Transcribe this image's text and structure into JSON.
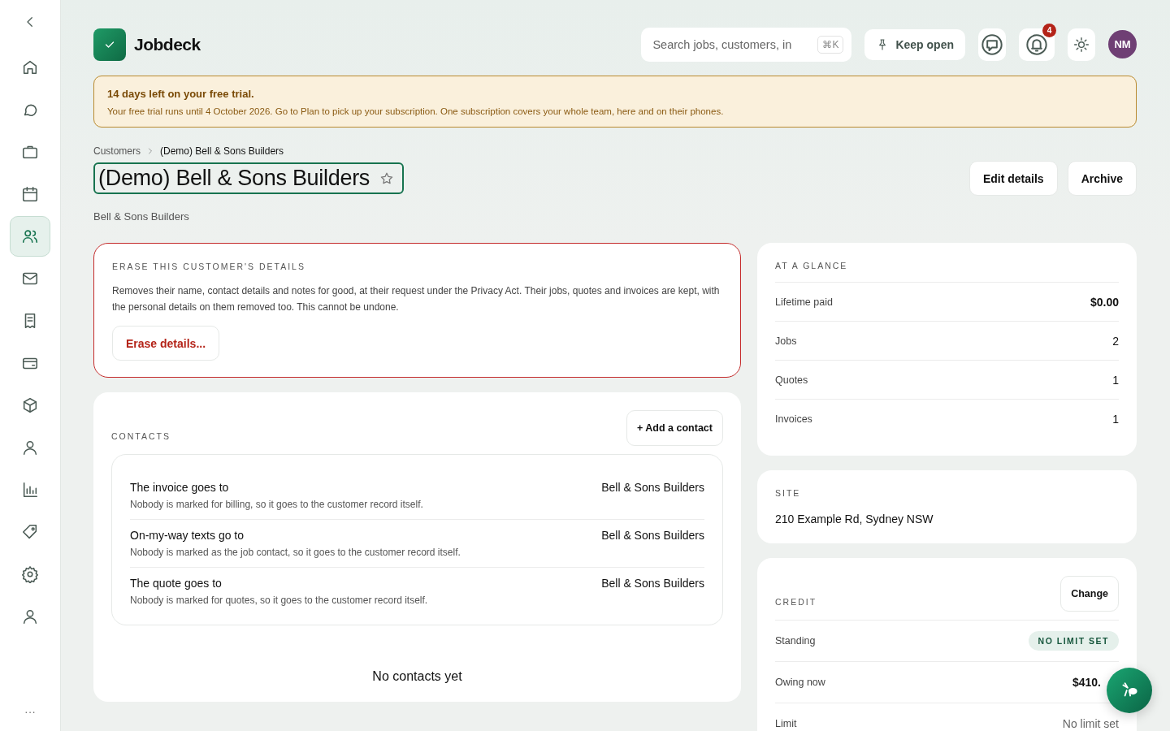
{
  "sidebar": {
    "items": [
      {
        "selected": false
      },
      {
        "selected": false
      },
      {
        "selected": false
      },
      {
        "selected": false
      },
      {
        "selected": true
      },
      {
        "selected": false
      },
      {
        "selected": false
      },
      {
        "selected": false
      },
      {
        "selected": false
      },
      {
        "selected": false
      },
      {
        "selected": false
      },
      {
        "selected": false
      },
      {
        "selected": false
      },
      {
        "selected": false
      }
    ],
    "more": "···"
  },
  "header": {
    "app_name": "Jobdeck",
    "search": {
      "placeholder": "Search jobs, customers, in",
      "shortcut": "⌘K"
    },
    "keep_open": "Keep open",
    "notifications": "4",
    "avatar": "NM"
  },
  "trial_banner": {
    "title": "14 days left on your free trial.",
    "text": "Your free trial runs until 4 October 2026. Go to Plan to pick up your subscription. One subscription covers your whole team, here and on their phones."
  },
  "breadcrumb": [
    "Customers",
    "(Demo) Bell & Sons Builders"
  ],
  "title": "(Demo) Bell & Sons Builders",
  "favorite": false,
  "subtitle": "Bell & Sons Builders",
  "actions": [
    "Edit details",
    "Archive"
  ],
  "erase": {
    "heading": "ERASE THIS CUSTOMER'S DETAILS",
    "text": "Removes their name, contact details and notes for good, at their request under the Privacy Act. Their jobs, quotes and invoices are kept, with the personal details on them removed too. This cannot be undone.",
    "button": "Erase details..."
  },
  "contacts": {
    "heading": "CONTACTS",
    "add_button": "+ Add a contact",
    "routes": [
      {
        "title": "The invoice goes to",
        "note": "Nobody is marked for billing, so it goes to the customer record itself.",
        "target": "Bell & Sons Builders"
      },
      {
        "title": "On-my-way texts go to",
        "note": "Nobody is marked as the job contact, so it goes to the customer record itself.",
        "target": "Bell & Sons Builders"
      },
      {
        "title": "The quote goes to",
        "note": "Nobody is marked for quotes, so it goes to the customer record itself.",
        "target": "Bell & Sons Builders"
      }
    ],
    "empty": "No contacts yet"
  },
  "glance": {
    "heading": "AT A GLANCE",
    "rows": [
      {
        "label": "Lifetime paid",
        "value": "$0.00",
        "bold": true
      },
      {
        "label": "Jobs",
        "value": "2",
        "bold": false
      },
      {
        "label": "Quotes",
        "value": "1",
        "bold": false
      },
      {
        "label": "Invoices",
        "value": "1",
        "bold": false
      }
    ]
  },
  "site": {
    "heading": "SITE",
    "address": "210 Example Rd, Sydney NSW"
  },
  "credit": {
    "heading": "CREDIT",
    "button": "Change",
    "rows": [
      {
        "label": "Standing",
        "kind": "badge",
        "value": "NO LIMIT SET"
      },
      {
        "label": "Owing now",
        "kind": "bold",
        "value": "$410."
      },
      {
        "label": "Limit",
        "kind": "plain",
        "value": "No limit set"
      }
    ]
  }
}
